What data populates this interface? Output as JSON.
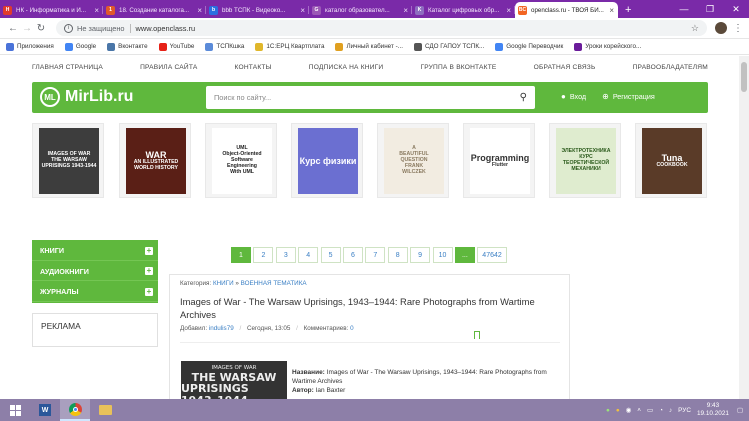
{
  "browser": {
    "tabs": [
      {
        "label": "НК - Информатика и И...",
        "color": "#e03b2b",
        "glyph": "Н"
      },
      {
        "label": "18. Создание каталога...",
        "color": "#e05a2b",
        "glyph": "1"
      },
      {
        "label": "bbb ТСПК - Видеоко...",
        "color": "#2b6ee0",
        "glyph": "b"
      },
      {
        "label": "каталог образовател...",
        "color": "#9b59b6",
        "glyph": "G"
      },
      {
        "label": "Каталог цифровых обр...",
        "color": "#8e6cc0",
        "glyph": "K"
      },
      {
        "label": "openclass.ru - ТВОЯ БИ...",
        "color": "#f26522",
        "glyph": "BC",
        "active": true
      }
    ],
    "new_tab": "+",
    "window_controls": [
      "—",
      "❐",
      "✕"
    ],
    "security_label": "Не защищено",
    "url": "www.openclass.ru",
    "bookmarks": [
      {
        "label": "Приложения",
        "color": "#4a73d9"
      },
      {
        "label": "Google",
        "color": "#4285f4"
      },
      {
        "label": "Вконтакте",
        "color": "#4a76a8"
      },
      {
        "label": "YouTube",
        "color": "#e62117"
      },
      {
        "label": "ТСПКшка",
        "color": "#5b8bd9"
      },
      {
        "label": "1С:ЕРЦ Квартплата",
        "color": "#e0b72b"
      },
      {
        "label": "Личный кабинет -...",
        "color": "#e0a020"
      },
      {
        "label": "СДО ГАПОУ ТСПК...",
        "color": "#555555"
      },
      {
        "label": "Google Переводчик",
        "color": "#4285f4"
      },
      {
        "label": "Уроки корейского...",
        "color": "#6a1b9a"
      }
    ]
  },
  "site": {
    "top_nav": [
      "ГЛАВНАЯ СТРАНИЦА",
      "ПРАВИЛА САЙТА",
      "КОНТАКТЫ",
      "ПОДПИСКА НА КНИГИ",
      "ГРУППА В ВКОНТАКТЕ",
      "ОБРАТНАЯ СВЯЗЬ",
      "ПРАВООБЛАДАТЕЛЯМ"
    ],
    "logo_badge": "ML",
    "logo_text": "MirLib.ru",
    "search_placeholder": "Поиск по сайту...",
    "login": "Вход",
    "register": "Регистрация",
    "covers": [
      {
        "lines": [
          "IMAGES OF WAR",
          "THE WARSAW",
          "UPRISINGS 1943-1944"
        ],
        "bg": "#3d3d3d",
        "fg": "#ffffff"
      },
      {
        "lines": [
          "WAR",
          "AN ILLUSTRATED WORLD HISTORY"
        ],
        "bg": "#5a1f16",
        "fg": "#ffffff"
      },
      {
        "lines": [
          "UML",
          "Object-Oriented",
          "Software",
          "Engineering",
          "With UML"
        ],
        "bg": "#ffffff",
        "fg": "#222222"
      },
      {
        "lines": [
          "Курс физики"
        ],
        "bg": "#6b6fd1",
        "fg": "#ffffff"
      },
      {
        "lines": [
          "A",
          "BEAUTIFUL",
          "QUESTION",
          "FRANK",
          "WILCZEK"
        ],
        "bg": "#f2ece1",
        "fg": "#8a7a60"
      },
      {
        "lines": [
          "Programming",
          "Flutter"
        ],
        "bg": "#ffffff",
        "fg": "#333333"
      },
      {
        "lines": [
          "ЭЛЕКТРОТЕХНИКА",
          "КУРС",
          "ТЕОРЕТИЧЕСКОЙ",
          "МЕХАНИКИ"
        ],
        "bg": "#dfeccf",
        "fg": "#2b5a1b"
      },
      {
        "lines": [
          "Tuna",
          "COOKBOOK"
        ],
        "bg": "#5a3b28",
        "fg": "#ffffff"
      }
    ],
    "side_menu": [
      "КНИГИ",
      "АУДИОКНИГИ",
      "ЖУРНАЛЫ"
    ],
    "ad_label": "РЕКЛАМА",
    "pagination": [
      "1",
      "2",
      "3",
      "4",
      "5",
      "6",
      "7",
      "8",
      "9",
      "10",
      "...",
      "47642"
    ],
    "article": {
      "category_label": "Категория:",
      "category_1": "КНИГИ",
      "category_sep": "»",
      "category_2": "ВОЕННАЯ ТЕМАТИКА",
      "title": "Images of War - The Warsaw Uprisings, 1943–1944: Rare Photographs from Wartime Archives",
      "added_label": "Добавил:",
      "author_user": "indulis79",
      "date": "Сегодня, 13:05",
      "comments_label": "Комментариев:",
      "comments_count": "0",
      "thumb_lines": [
        "IMAGES OF WAR",
        "THE WARSAW",
        "UPRISINGS 1943–1944"
      ],
      "name_label": "Название:",
      "name_value": "Images of War - The Warsaw Uprisings, 1943–1944: Rare Photographs from Wartime Archives",
      "author_label": "Автор:",
      "author_value": "Ian Baxter"
    }
  },
  "taskbar": {
    "lang": "РУС",
    "time": "9:43",
    "date": "19.10.2021"
  }
}
